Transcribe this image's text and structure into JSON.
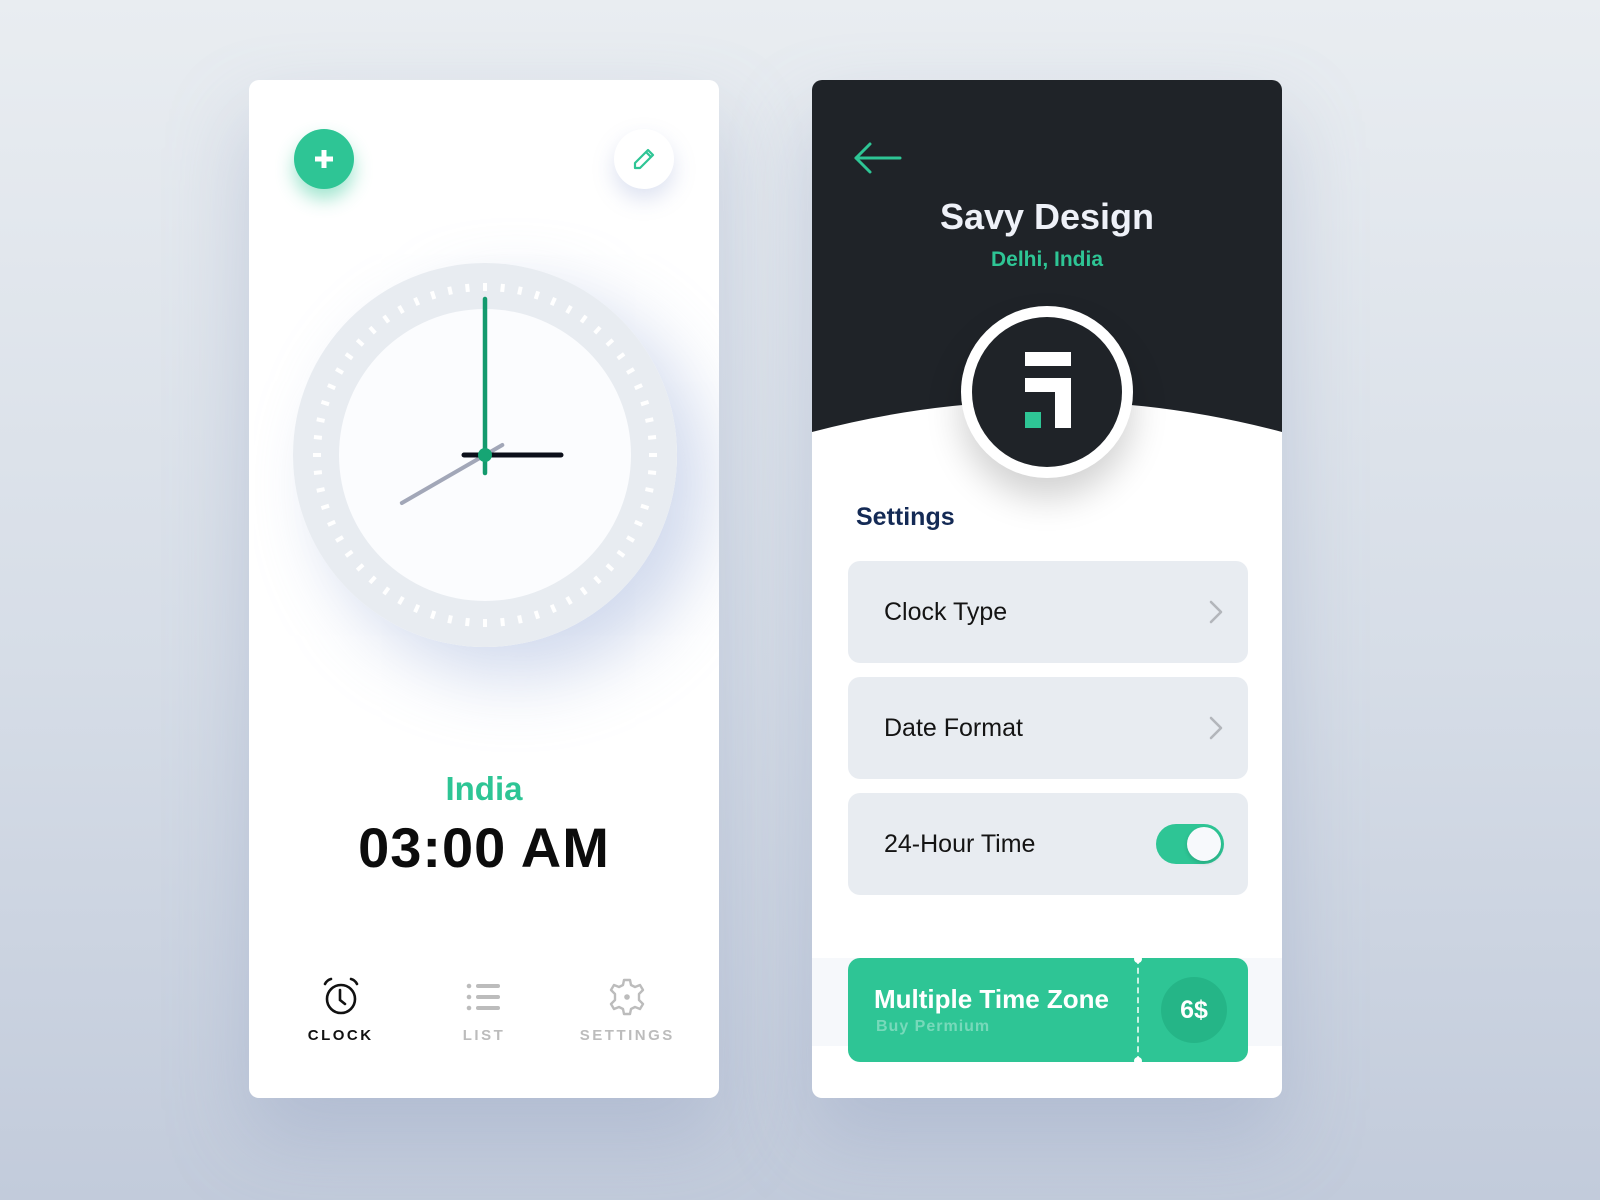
{
  "clock_screen": {
    "add_button": {
      "icon": "plus-icon"
    },
    "edit_button": {
      "icon": "pencil-icon"
    },
    "analog_clock": {
      "hour": 3,
      "minute": 0,
      "second": 40,
      "tick_count": 60
    },
    "city": "India",
    "time": "03:00 AM",
    "nav": [
      {
        "label": "CLOCK",
        "icon": "alarm-clock-icon",
        "active": true
      },
      {
        "label": "LIST",
        "icon": "list-icon",
        "active": false
      },
      {
        "label": "SETTINGS",
        "icon": "gear-icon",
        "active": false
      }
    ]
  },
  "settings_screen": {
    "back_icon": "arrow-left-icon",
    "profile": {
      "name": "Savy Design",
      "location": "Delhi, India",
      "logo": "savy-logo"
    },
    "section_title": "Settings",
    "rows": [
      {
        "label": "Clock Type",
        "control": "chevron"
      },
      {
        "label": "Date Format",
        "control": "chevron"
      },
      {
        "label": "24-Hour Time",
        "control": "toggle",
        "value": true
      }
    ],
    "promo": {
      "title": "Multiple Time Zone",
      "subtitle": "Buy Permium",
      "price": "6$"
    }
  },
  "colors": {
    "accent": "#2ec595",
    "accent_dark": "#25b587",
    "dark_header": "#1f2328",
    "settings_title": "#142a55",
    "row_bg": "#e8ecf1",
    "nav_inactive": "#bcbcbc"
  }
}
